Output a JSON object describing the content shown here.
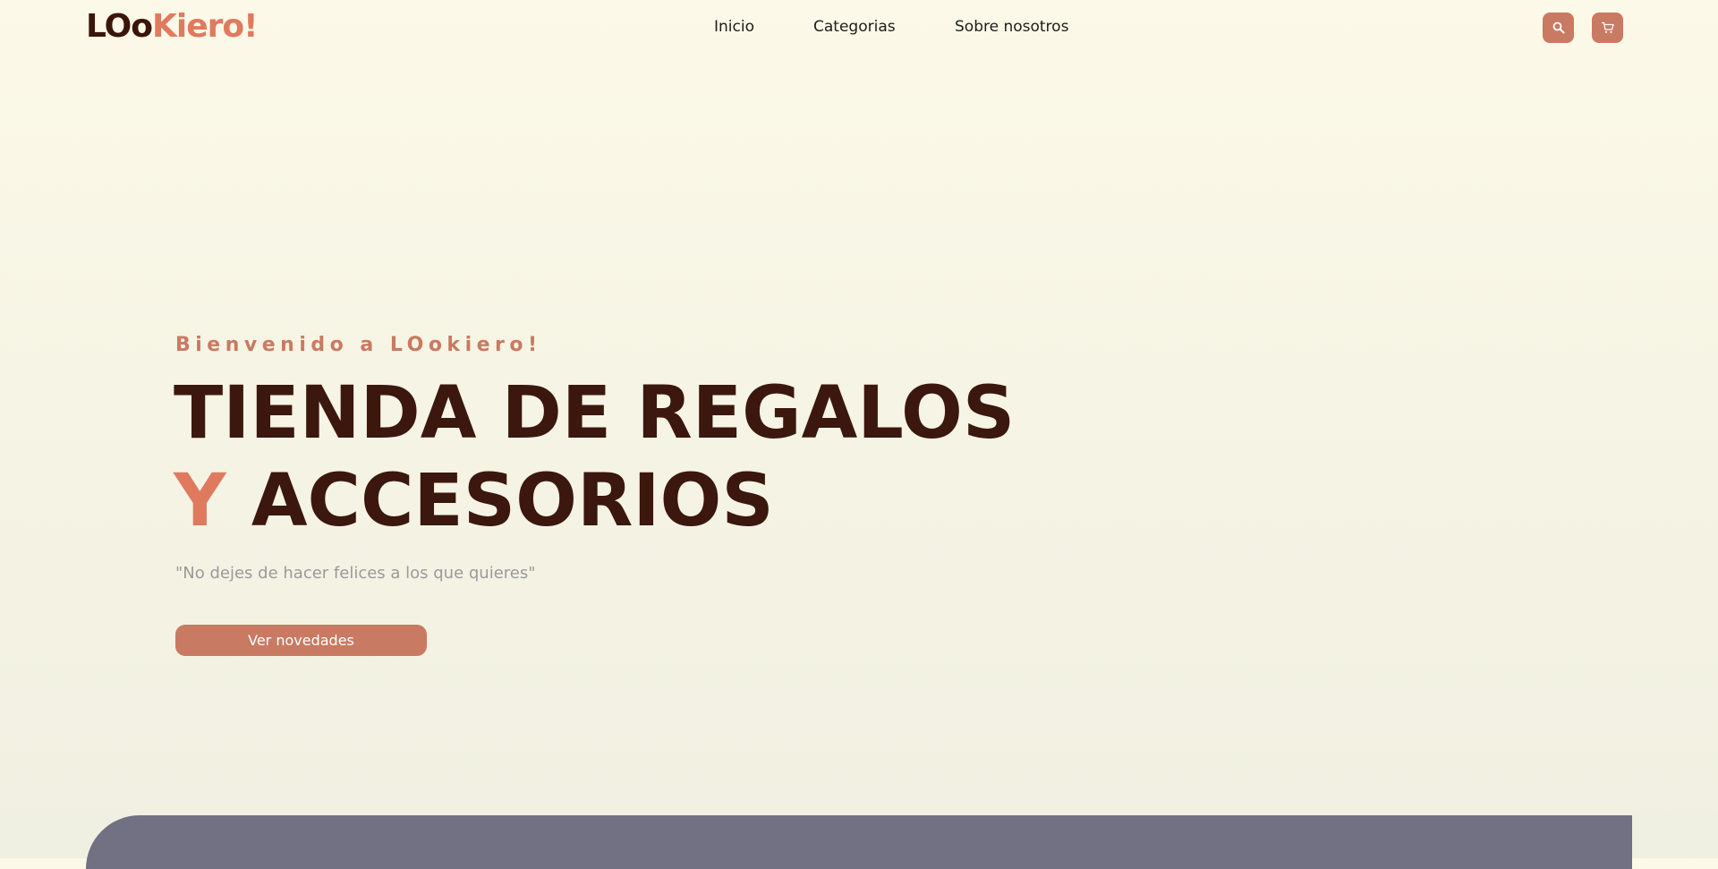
{
  "brand": {
    "logo_dark": "LOo",
    "logo_accent": "Kiero!",
    "colors": {
      "accent": "#c97a62",
      "accent_bright": "#e07a5f",
      "dark": "#3b170e",
      "panel": "#727083"
    }
  },
  "nav": {
    "items": [
      {
        "label": "Inicio"
      },
      {
        "label": "Categorias"
      },
      {
        "label": "Sobre nosotros"
      }
    ]
  },
  "header_actions": {
    "search_icon": "search-icon",
    "cart_icon": "cart-icon"
  },
  "hero": {
    "kicker": "Bienvenido a LOokiero!",
    "title_line1": "TIENDA DE REGALOS",
    "title_line2_accent": "Y",
    "title_line2_rest": "ACCESORIOS",
    "quote": "\"No dejes de hacer felices a los que quieres\"",
    "cta_label": "Ver novedades"
  }
}
